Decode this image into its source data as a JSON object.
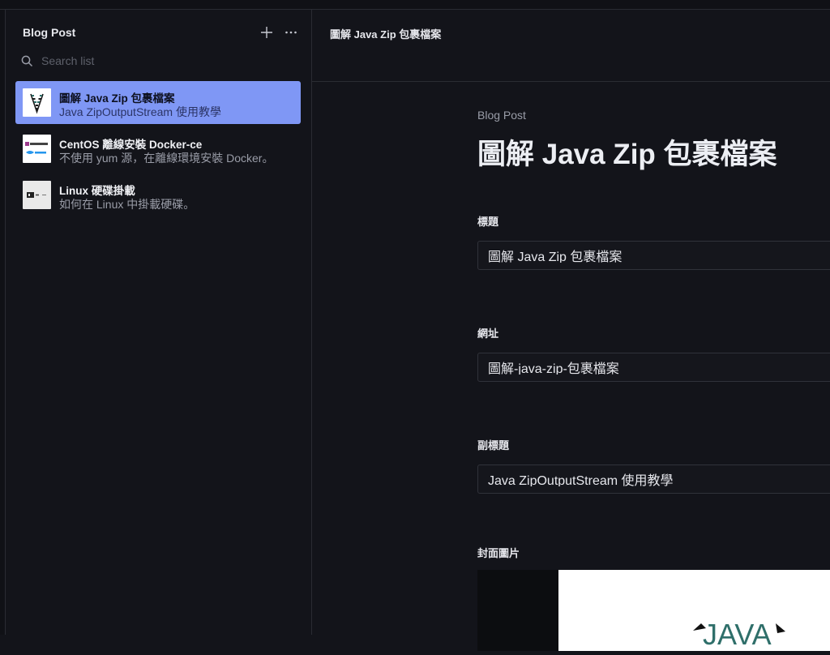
{
  "sidebar": {
    "title": "Blog Post",
    "search_placeholder": "Search list",
    "items": [
      {
        "title": "圖解 Java Zip 包裹檔案",
        "subtitle": "Java ZipOutputStream 使用教學",
        "thumb": "zipper-icon"
      },
      {
        "title": "CentOS 離線安裝 Docker-ce",
        "subtitle": "不使用 yum 源，在離線環境安裝 Docker。",
        "thumb": "centos-docker-logo"
      },
      {
        "title": "Linux 硬碟掛載",
        "subtitle": "如何在 Linux 中掛載硬碟。",
        "thumb": "disk-mount-icon"
      }
    ]
  },
  "main": {
    "breadcrumb": "圖解 Java Zip 包裹檔案",
    "doc_type": "Blog Post",
    "doc_title": "圖解 Java Zip 包裹檔案",
    "fields": {
      "title_label": "標題",
      "title_value": "圖解 Java Zip 包裹檔案",
      "slug_label": "網址",
      "slug_value": "圖解-java-zip-包裹檔案",
      "subtitle_label": "副標題",
      "subtitle_value": "Java ZipOutputStream 使用教學",
      "cover_label": "封面圖片"
    },
    "cover_logo_text": "JAVA"
  },
  "colors": {
    "background": "#13141a",
    "active_item": "#7f97f5",
    "border": "#2a2c33"
  }
}
